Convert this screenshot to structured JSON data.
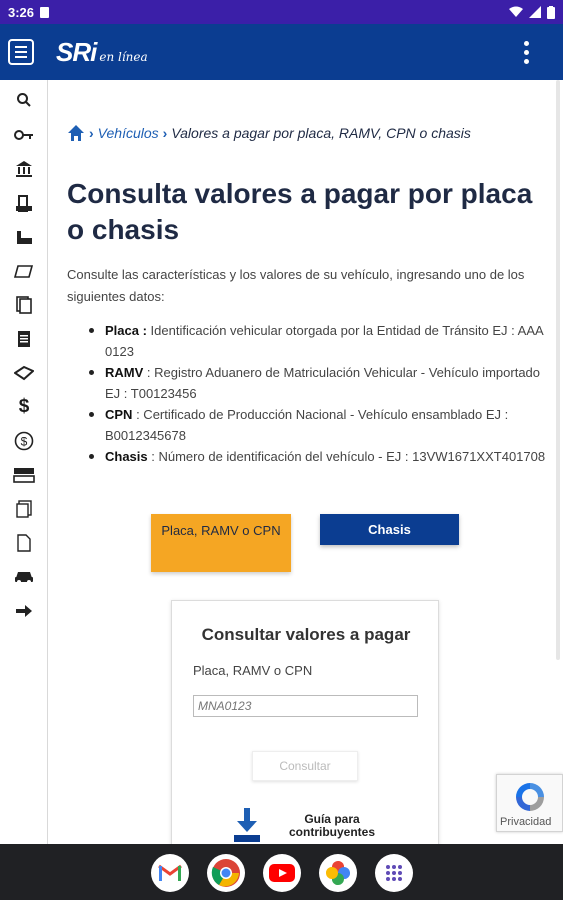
{
  "status_bar": {
    "time": "3:26"
  },
  "app_bar": {
    "logo_main": "SRi",
    "logo_sub": "en línea"
  },
  "breadcrumb": {
    "section": "Vehículos",
    "current": "Valores a pagar por placa, RAMV, CPN o chasis"
  },
  "page_title": "Consulta valores a pagar por placa o chasis",
  "intro": "Consulte las características y los valores de su vehículo, ingresando uno de los siguientes datos:",
  "definitions": [
    {
      "term": "Placa :",
      "text": "Identificación vehicular otorgada por la Entidad de Tránsito EJ : AAA 0123"
    },
    {
      "term": "RAMV",
      "text": ": Registro Aduanero de Matriculación Vehicular - Vehículo importado EJ : T00123456"
    },
    {
      "term": "CPN",
      "text": ": Certificado de Producción Nacional - Vehículo ensamblado EJ : B0012345678"
    },
    {
      "term": "Chasis",
      "text": ": Número de identificación del vehículo - EJ : 13VW1671XXT401708"
    }
  ],
  "buttons": {
    "placa": "Placa, RAMV o CPN",
    "chasis": "Chasis"
  },
  "form": {
    "title": "Consultar valores a pagar",
    "label": "Placa, RAMV o CPN",
    "placeholder": "MNA0123",
    "submit": "Consultar"
  },
  "guide": {
    "label": "Guía para contribuyentes"
  },
  "recaptcha": {
    "label": "Privacidad"
  },
  "colors": {
    "brand_blue": "#0b3d91",
    "accent_orange": "#f5a623",
    "status_purple": "#3b1fa8"
  },
  "sidebar_icons": [
    "search-icon",
    "key-icon",
    "bank-icon",
    "building-icon",
    "factory-icon",
    "folder-icon",
    "documents-icon",
    "document-icon",
    "hand-money-icon",
    "dollar-icon",
    "coin-icon",
    "exchange-icon",
    "forms-icon",
    "receipt-icon",
    "car-icon",
    "arrow-right-icon"
  ],
  "dock_apps": [
    "gmail-icon",
    "chrome-icon",
    "youtube-icon",
    "photos-icon",
    "apps-icon"
  ]
}
